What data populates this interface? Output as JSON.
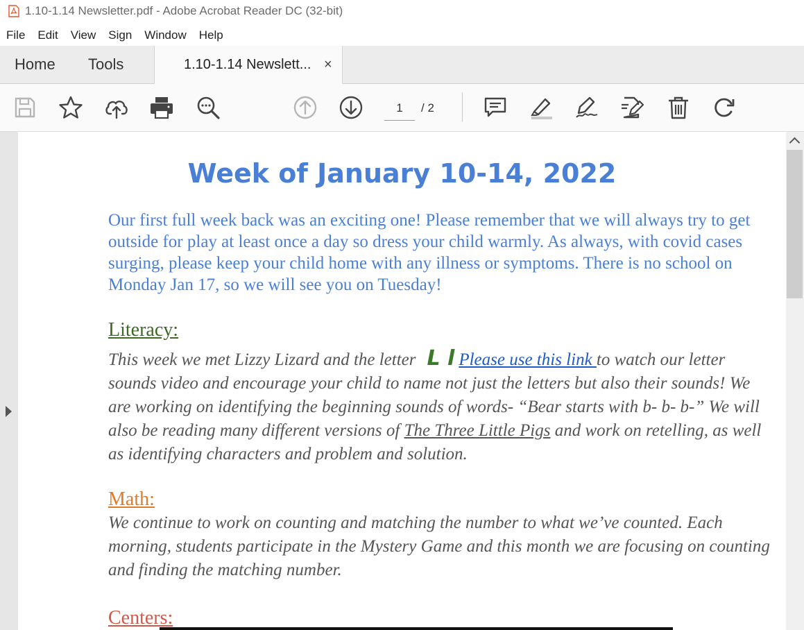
{
  "window": {
    "title": "1.10-1.14 Newsletter.pdf - Adobe Acrobat Reader DC (32-bit)"
  },
  "menu": [
    "File",
    "Edit",
    "View",
    "Sign",
    "Window",
    "Help"
  ],
  "tabs": {
    "home": "Home",
    "tools": "Tools",
    "document": "1.10-1.14 Newslett...",
    "close": "×"
  },
  "toolbar": {
    "icons": [
      "save-icon",
      "star-icon",
      "upload-icon",
      "print-icon",
      "zoom-icon",
      "page-up-icon",
      "page-down-icon",
      "comment-icon",
      "highlight-icon",
      "sign-icon",
      "edit-pdf-icon",
      "delete-icon",
      "rotate-icon"
    ],
    "page_current": "1",
    "page_total": "/ 2"
  },
  "document": {
    "heading": "Week of January 10-14, 2022",
    "intro": "Our first full week back was an exciting one! Please remember that we will always try to get outside for play at least once a day so dress your child warmly. As always, with covid cases surging, please keep your child home with any illness or symptoms. There is no school on Monday Jan 17, so we will see you on Tuesday!",
    "literacy": {
      "title": "Literacy:",
      "text_before": "This week we met Lizzy Lizard and the letter",
      "letter": "L l",
      "link": "Please use this link ",
      "text_mid": "to watch our letter sounds video and encourage your child to name not just the letters but also their sounds! We are working on identifying the beginning sounds of words- “Bear starts with b- b- b-” We will also be reading many different versions of ",
      "book": "The Three Little Pigs",
      "text_after": " and work on retelling, as well as identifying characters and problem and solution."
    },
    "math": {
      "title": "Math:",
      "text": "We continue to work on counting and matching the number to what we’ve counted. Each morning, students participate in the Mystery Game and this month we are focusing on counting and finding the matching number."
    },
    "centers": {
      "title": "Centers:"
    }
  },
  "colors": {
    "heading_blue": "#4a7fd6",
    "literacy_green": "#3b6b22",
    "math_orange": "#e07b28",
    "centers_red": "#cf5a4a",
    "link_blue": "#1f5bc7"
  }
}
